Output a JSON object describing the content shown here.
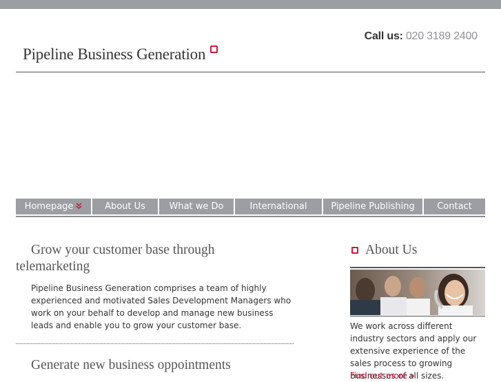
{
  "header": {
    "call_label": "Call us:",
    "phone": "020 3189 2400",
    "logo_text": "Pipeline Business Generation"
  },
  "nav": {
    "items": [
      {
        "label": "Homepage",
        "has_arrow": true
      },
      {
        "label": "About Us"
      },
      {
        "label": "What we Do"
      },
      {
        "label": "International"
      },
      {
        "label": "Pipeline Publishing"
      },
      {
        "label": "Contact"
      }
    ],
    "arrow": "»"
  },
  "main": {
    "heading1": "Grow your customer base through telemarketing",
    "paragraph1": "Pipeline Business Generation comprises a team of highly experienced and motivated Sales Development Managers who work on your behalf to develop and manage new business leads and enable you to grow your customer base.",
    "heading2": "Generate new business oppointments"
  },
  "sidebar": {
    "title": "About Us",
    "text": "We work across different industry sectors and apply our extensive experience of the sales process to growing businesses of all sizes.",
    "link": "Find out more »"
  },
  "colors": {
    "accent": "#c8193c",
    "nav_bg": "#9c9ea3",
    "topbar": "#9b9ea3"
  }
}
